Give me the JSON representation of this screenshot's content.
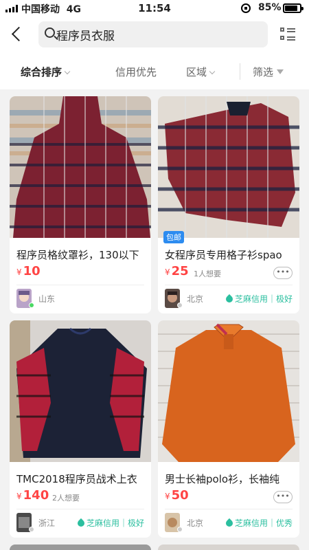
{
  "status_bar": {
    "carrier": "中国移动",
    "network": "4G",
    "time": "11:54",
    "battery": "85%",
    "battery_level": 0.85
  },
  "search": {
    "query": "程序员衣服"
  },
  "filters": {
    "items": [
      {
        "label": "综合排序"
      },
      {
        "label": "信用优先"
      },
      {
        "label": "区域"
      },
      {
        "label": "筛选"
      }
    ]
  },
  "products": [
    {
      "title": "程序员格纹罩衫，130以下",
      "currency": "¥",
      "price": "10",
      "wants": "",
      "badge": "",
      "location": "山东",
      "credit": "",
      "online_color": "#4cd964"
    },
    {
      "title": "女程序员专用格子衫spao",
      "currency": "¥",
      "price": "25",
      "wants": "1人想要",
      "badge": "包邮",
      "location": "北京",
      "credit": "芝麻信用｜极好",
      "online_color": "#cccccc"
    },
    {
      "title": "TMC2018程序员战术上衣",
      "currency": "¥",
      "price": "140",
      "wants": "2人想要",
      "badge": "",
      "location": "浙江",
      "credit": "芝麻信用｜极好",
      "online_color": "#cccccc"
    },
    {
      "title": "男士长袖polo衫，长袖纯",
      "currency": "¥",
      "price": "50",
      "wants": "",
      "badge": "",
      "location": "北京",
      "credit": "芝麻信用｜优秀",
      "online_color": "#cccccc"
    }
  ],
  "more_label": "•••"
}
